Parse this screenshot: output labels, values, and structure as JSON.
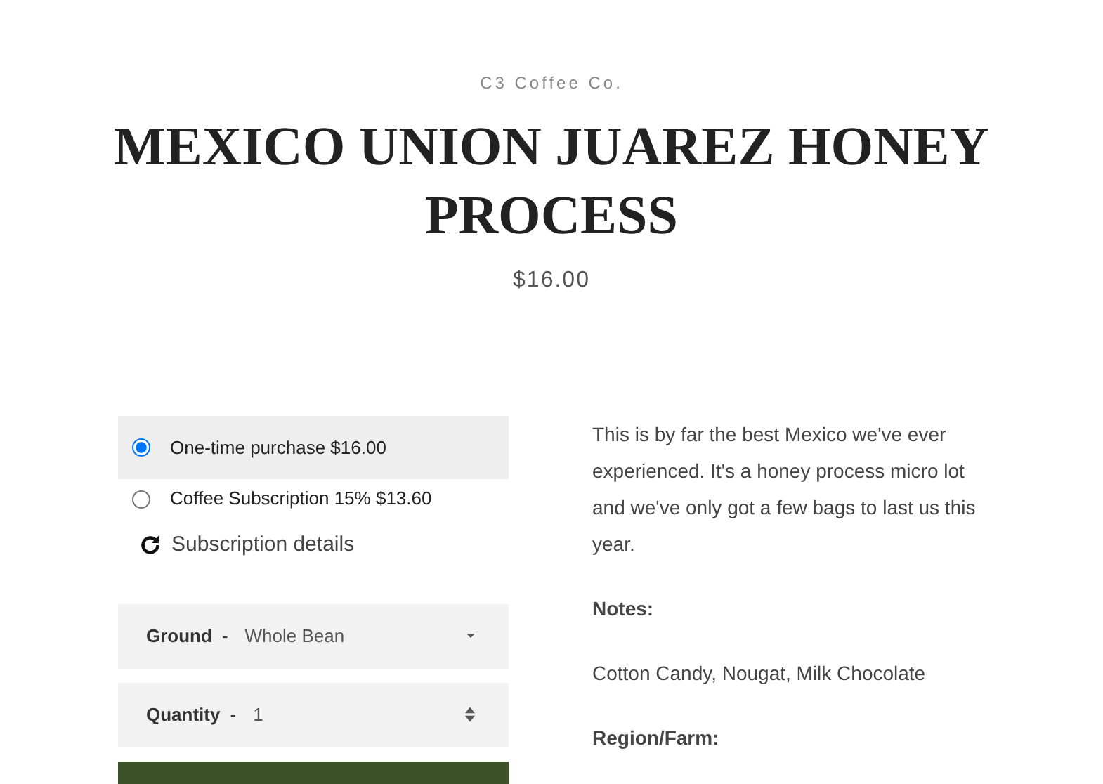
{
  "vendor": "C3 Coffee Co.",
  "title": "MEXICO UNION JUAREZ HONEY PROCESS",
  "price": "$16.00",
  "purchase_options": [
    {
      "label": "One-time purchase $16.00",
      "selected": true
    },
    {
      "label": "Coffee Subscription 15% $13.60",
      "selected": false
    }
  ],
  "subscription_link": "Subscription details",
  "ground": {
    "label": "Ground",
    "separator": "-",
    "value": "Whole Bean"
  },
  "quantity": {
    "label": "Quantity",
    "separator": "-",
    "value": "1"
  },
  "description": [
    {
      "kind": "paragraph",
      "text": "This is by far the best Mexico we've ever experienced. It's a honey process micro lot and we've only got a few bags to last us this year."
    },
    {
      "kind": "heading",
      "text": "Notes:"
    },
    {
      "kind": "paragraph",
      "text": "Cotton Candy, Nougat, Milk Chocolate"
    },
    {
      "kind": "heading",
      "text": "Region/Farm:"
    }
  ]
}
